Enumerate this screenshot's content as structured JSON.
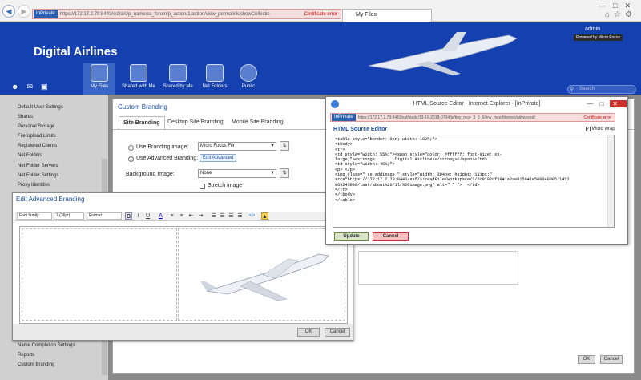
{
  "browser": {
    "inprivate": "InPrivate",
    "url": "https://172.17.2.79:8443/ssf/a/c/p_name/ss_forum/p_action/1/action/view_permalink/showCollectic",
    "cert_error": "Certificate error",
    "tab_title": "My Files"
  },
  "app": {
    "brand": "Digital Airlines",
    "user": "admin",
    "powered_by": "Powered by Micro Focus",
    "nav": [
      "My Files",
      "Shared with Me",
      "Shared by Me",
      "Net Folders",
      "Public"
    ],
    "search_placeholder": "Search"
  },
  "sidebar": {
    "items": [
      "Default User Settings",
      "Shares",
      "Personal Storage",
      "File Upload Limits",
      "Registered Clients",
      "Net Folders",
      "Net Folder Servers",
      "Net Folder Settings",
      "Proxy Identities"
    ],
    "bottom_items": [
      "Name Completion Settings",
      "Reports",
      "Custom Branding"
    ]
  },
  "custom_branding": {
    "title": "Custom Branding",
    "tabs": [
      "Site Branding",
      "Desktop Site Branding",
      "Mobile Site Branding"
    ],
    "use_branding_image": "Use Branding image:",
    "branding_image_value": "Micro Focus Filr",
    "use_advanced_branding": "Use Advanced Branding:",
    "edit_advanced": "Edit Advanced",
    "background_image": "Background Image:",
    "background_value": "None",
    "stretch_image": "Stretch image",
    "ok": "OK",
    "cancel": "Cancel"
  },
  "advanced_branding": {
    "title": "Edit Advanced Branding",
    "toolbar": {
      "font_family": "Font family",
      "font_size": "7 (36pt)",
      "format": "Format"
    },
    "ok": "OK",
    "cancel": "Cancel"
  },
  "html_editor": {
    "window_title": "HTML Source Editor - Internet Explorer - [InPrivate]",
    "inprivate": "InPrivate",
    "url": "https://172.17.2.79:8443/ssf/static/13-10-2018-0704/js/tiny_mce_3_5_6/tiny_mce/themes/advanced/",
    "cert_error": "Certificate error",
    "heading": "HTML Source Editor",
    "word_wrap": "Word wrap",
    "source": "<table style=\"border: 0px; width: 100%;\">\n<tbody>\n<tr>\n<td style=\"width: 55%;\"><span style=\"color: #ffffff; font-size: xx-\nlarge;\"><strong>        Digital Airlines</strong></span></td>\n<td style=\"width: 45%;\">\n<p> </p>\n<img class=\" ss_addimage \" style=\"width: 394px; height: 111px;\"\nsrc=\"https://172.17.2.79:8443/ssf/s/readFile/workspace/1/2c9182cf5941a2ae015941e500040005/1452\n869243000/last/about%20filr%20image.png\" alt=\" \" />  </td>\n</tr>\n</tbody>\n</table>",
    "update": "Update",
    "cancel": "Cancel"
  }
}
